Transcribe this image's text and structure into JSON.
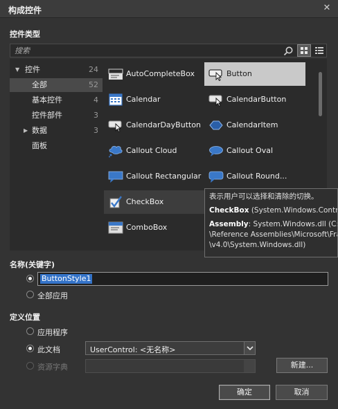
{
  "window": {
    "title": "构成控件"
  },
  "icons": {
    "close": "close-icon",
    "search": "search-icon",
    "grid_view": "grid-view-icon",
    "list_view": "list-view-icon"
  },
  "controls_section": {
    "label": "控件类型"
  },
  "search": {
    "placeholder": "搜索",
    "value": ""
  },
  "categories": [
    {
      "label": "控件",
      "count": "24",
      "arrow": "▼",
      "selected": false
    },
    {
      "label": "全部",
      "count": "52",
      "arrow": "",
      "selected": true
    },
    {
      "label": "基本控件",
      "count": "4",
      "arrow": "",
      "selected": false
    },
    {
      "label": "控件部件",
      "count": "3",
      "arrow": "",
      "selected": false
    },
    {
      "label": "数据",
      "count": "3",
      "arrow": "▶",
      "selected": false
    },
    {
      "label": "面板",
      "count": "",
      "arrow": "",
      "selected": false
    }
  ],
  "controls": [
    {
      "label": "AutoCompleteBox",
      "icon": "autocompletebox-icon"
    },
    {
      "label": "Button",
      "icon": "button-icon",
      "selected": true
    },
    {
      "label": "Calendar",
      "icon": "calendar-icon"
    },
    {
      "label": "CalendarButton",
      "icon": "calendarbutton-icon"
    },
    {
      "label": "CalendarDayButton",
      "icon": "calendardaybutton-icon"
    },
    {
      "label": "CalendarItem",
      "icon": "calendaritem-icon"
    },
    {
      "label": "Callout Cloud",
      "icon": "callout-cloud-icon"
    },
    {
      "label": "Callout Oval",
      "icon": "callout-oval-icon"
    },
    {
      "label": "Callout Rectangular",
      "icon": "callout-rectangular-icon"
    },
    {
      "label": "Callout  Round...",
      "icon": "callout-rounded-icon"
    },
    {
      "label": "CheckBox",
      "icon": "checkbox-icon",
      "hover": true
    },
    {
      "label": "",
      "icon": ""
    },
    {
      "label": "ComboBox",
      "icon": "combobox-icon"
    }
  ],
  "tooltip": {
    "description": "表示用户可以选择和清除的切换。",
    "type_name": "CheckBox",
    "type_detail": " (System.Windows.Controls.CheckBox)",
    "assembly_label": "Assembly",
    "assembly_line1": ": System.Windows.dll (C:\\Program Files",
    "assembly_line2": "\\Reference Assemblies\\Microsoft\\Framework\\Silverlight",
    "assembly_line3": "\\v4.0\\System.Windows.dll)"
  },
  "name_section": {
    "label": "名称(关键字)",
    "name_value": "ButtonStyle1",
    "apply_all_label": "全部应用"
  },
  "define_section": {
    "label": "定义位置",
    "application_label": "应用程序",
    "this_document_label": "此文档",
    "document_select_value": "UserControl: <无名称>",
    "resource_dictionary_label": "资源字典",
    "new_button": "新建..."
  },
  "footer": {
    "ok": "确定",
    "cancel": "取消"
  }
}
